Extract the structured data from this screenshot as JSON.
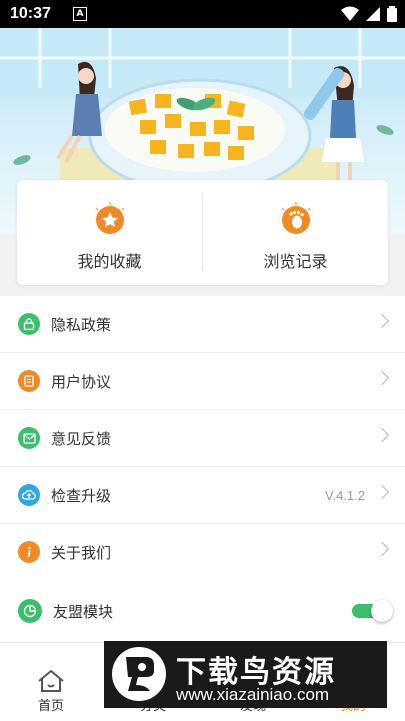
{
  "status_bar": {
    "time": "10:37",
    "notification_badge": "A"
  },
  "quick_actions": [
    {
      "label": "我的收藏",
      "icon": "star-icon"
    },
    {
      "label": "浏览记录",
      "icon": "footprint-icon"
    }
  ],
  "menu": [
    {
      "label": "隐私政策",
      "icon": "lock-icon",
      "color": "#3bbf6b"
    },
    {
      "label": "用户协议",
      "icon": "document-icon",
      "color": "#f08a24"
    },
    {
      "label": "意见反馈",
      "icon": "mail-icon",
      "color": "#3bbf6b"
    },
    {
      "label": "检查升级",
      "icon": "cloud-upload-icon",
      "color": "#2ea6e8",
      "value": "V.4.1.2"
    },
    {
      "label": "关于我们",
      "icon": "info-icon",
      "color": "#f08a24"
    }
  ],
  "toggle_row": {
    "label": "友盟模块",
    "enabled": true,
    "icon": "pie-chart-icon",
    "color": "#3bbf6b"
  },
  "tabbar": [
    {
      "label": "首页",
      "icon": "home-icon"
    },
    {
      "label": "分类",
      "icon": "grid-icon"
    },
    {
      "label": "发现",
      "icon": "compass-icon"
    },
    {
      "label": "我的",
      "icon": "user-icon"
    }
  ],
  "watermark": {
    "title": "下载鸟资源",
    "url": "www.xiazainiao.com"
  }
}
